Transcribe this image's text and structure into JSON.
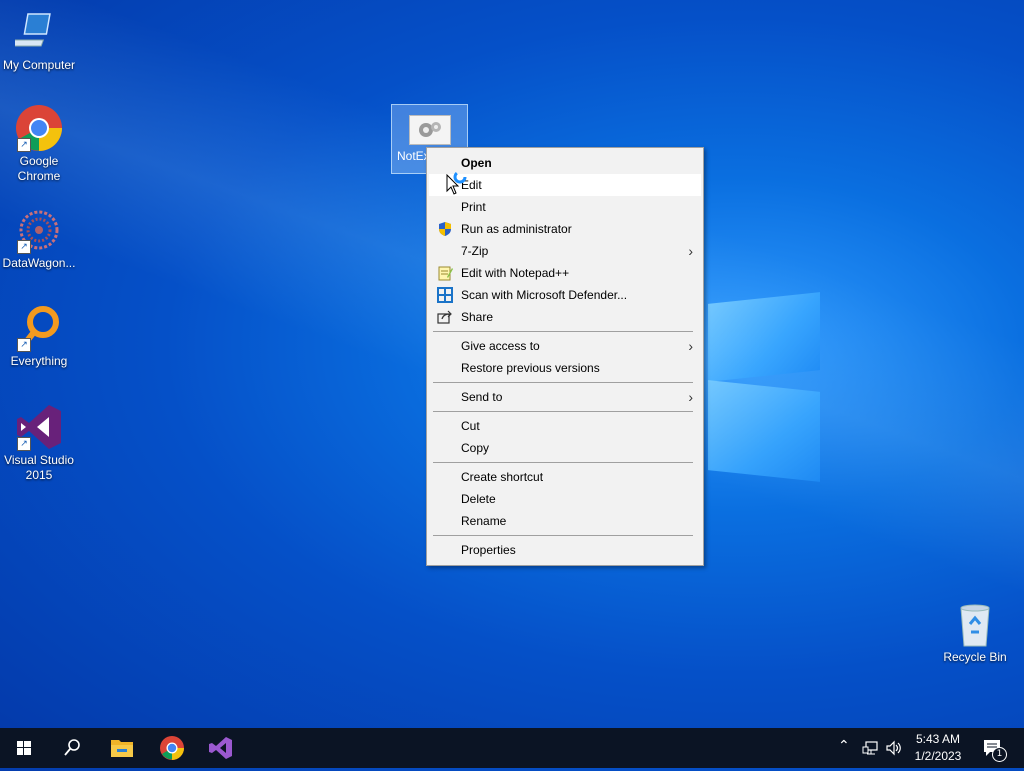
{
  "desktop": {
    "icons": [
      {
        "label": "My Computer",
        "icon": "computer-icon"
      },
      {
        "label": "Google Chrome",
        "icon": "chrome-icon",
        "line1": "Google",
        "line2": "Chrome"
      },
      {
        "label": "DataWagon...",
        "icon": "datawagon-icon"
      },
      {
        "label": "Everything",
        "icon": "everything-icon"
      },
      {
        "label": "Visual Studio 2015",
        "icon": "visual-studio-icon",
        "line1": "Visual Studio",
        "line2": "2015"
      }
    ],
    "selected_file": {
      "label": "NotEx",
      "icon": "settings-file-icon"
    },
    "recycle_bin": {
      "label": "Recycle Bin",
      "icon": "recycle-bin-icon"
    }
  },
  "context_menu": {
    "items": [
      {
        "label": "Open",
        "bold": true
      },
      {
        "label": "Edit",
        "hover": true
      },
      {
        "label": "Print"
      },
      {
        "label": "Run as administrator",
        "icon": "uac-shield-icon"
      },
      {
        "label": "7-Zip",
        "submenu": true
      },
      {
        "label": "Edit with Notepad++",
        "icon": "notepad-plus-plus-icon"
      },
      {
        "label": "Scan with Microsoft Defender...",
        "icon": "defender-icon"
      },
      {
        "label": "Share",
        "icon": "share-icon"
      },
      {
        "label": "Give access to",
        "submenu": true
      },
      {
        "label": "Restore previous versions"
      },
      {
        "label": "Send to",
        "submenu": true
      },
      {
        "label": "Cut"
      },
      {
        "label": "Copy"
      },
      {
        "label": "Create shortcut"
      },
      {
        "label": "Delete"
      },
      {
        "label": "Rename"
      },
      {
        "label": "Properties"
      }
    ]
  },
  "taskbar": {
    "pinned": [
      "start-icon",
      "search-icon",
      "file-explorer-icon",
      "chrome-icon",
      "visual-studio-icon"
    ],
    "tray": {
      "time": "5:43 AM",
      "date": "1/2/2023",
      "notification_count": "1"
    }
  },
  "colors": {
    "accent": "#0a6fe0",
    "taskbar": "#0b1424",
    "menu_bg": "#f2f2f2"
  }
}
